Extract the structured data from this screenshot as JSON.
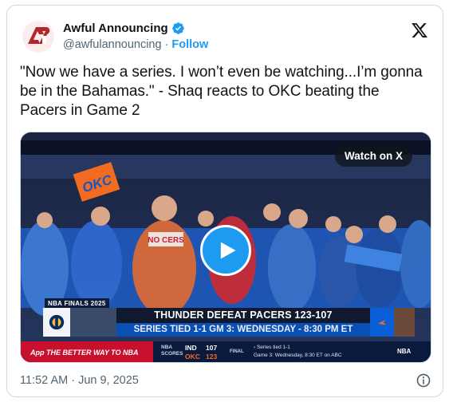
{
  "account": {
    "display_name": "Awful Announcing",
    "handle": "@awfulannouncing",
    "separator": "·",
    "follow_label": "Follow",
    "verified": true,
    "avatar_icon": "awful-announcing-logo",
    "brand_color": "#b0262b"
  },
  "tweet": {
    "text": "\"Now we have a series. I won’t even be watching...I’m gonna be in the Bahamas.\" - Shaq reacts to OKC beating the Pacers in Game 2",
    "timestamp": "11:52 AM · Jun 9, 2025"
  },
  "media": {
    "watch_label": "Watch on X",
    "play_icon": "play-icon",
    "lower_third": {
      "tag": "NBA FINALS 2025",
      "title": "THUNDER DEFEAT PACERS 123-107",
      "subtitle": "SERIES TIED 1-1    GM 3: WEDNESDAY - 8:30 PM ET",
      "app_banner": "App  THE BETTER WAY TO NBA",
      "ticker": {
        "label_top": "NBA",
        "label_bottom": "SCORES",
        "team1": "IND",
        "score1": "107",
        "team2": "OKC",
        "score2": "123",
        "status": "FINAL",
        "note1": "› Series tied 1-1",
        "note2": "Game 3: Wednesday, 8:30 ET on ABC",
        "network": "NBA"
      }
    },
    "fan_sign": "OKC",
    "fan_shirt": "NO CERS"
  },
  "colors": {
    "link": "#1d9bf0",
    "text_primary": "#0f1419",
    "text_secondary": "#536471",
    "border": "#cfd9de",
    "thunder_blue": "#0a5fd6"
  },
  "icons": {
    "close": "x-logo-icon",
    "info": "info-icon",
    "verified": "verified-badge-icon"
  }
}
